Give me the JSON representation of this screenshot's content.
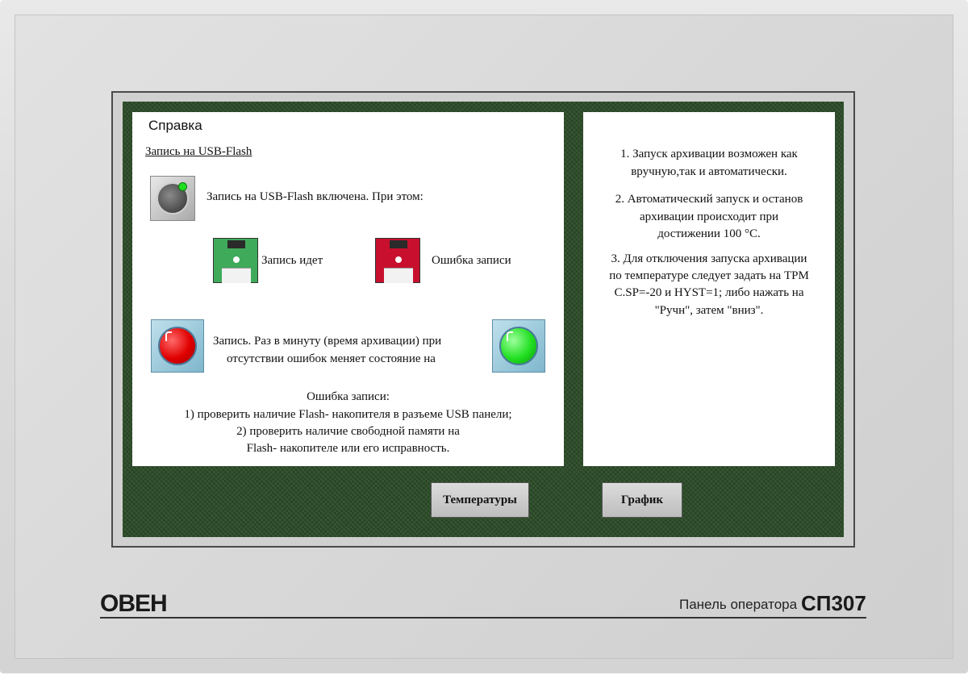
{
  "left_pane": {
    "title": "Справка",
    "subtitle": "Запись на USB-Flash",
    "usb_enabled_text": "Запись на USB-Flash включена. При этом:",
    "recording_label": "Запись идет",
    "error_label": "Ошибка записи",
    "lamp_text_line1": "Запись. Раз в минуту (время архивации) при",
    "lamp_text_line2": "отсутствии ошибок меняет состояние на",
    "error_block": {
      "line1": "Ошибка записи:",
      "line2": "1) проверить наличие Flash- накопителя в разъеме USB панели;",
      "line3": "2) проверить наличие свободной  памяти на",
      "line4": "Flash- накопителе или его исправность."
    }
  },
  "right_pane": {
    "item1_line1": "1. Запуск архивации возможен как",
    "item1_line2": "вручную,так и автоматически.",
    "item2_line1": "2. Автоматический запуск и останов",
    "item2_line2": "архивации происходит при",
    "item2_line3": "достижении 100 °С.",
    "item3_line1": "3. Для отключения запуска архивации",
    "item3_line2": "по температуре следует задать на ТРМ",
    "item3_line3": "С.SP=-20 и HYST=1; либо нажать на",
    "item3_line4": "\"Ручн\", затем \"вниз\"."
  },
  "buttons": {
    "temperatures": "Температуры",
    "graph": "График"
  },
  "device": {
    "brand": "ОВЕН",
    "panel_label": "Панель оператора",
    "model": "СП307"
  },
  "icons": {
    "knob": "usb-record-switch-icon",
    "floppy_ok": "floppy-ok-icon",
    "floppy_error": "floppy-error-icon",
    "lamp_red": "red-lamp-icon",
    "lamp_green": "green-lamp-icon"
  },
  "colors": {
    "screen_background": "#2a4a26",
    "floppy_ok": "#3faa5a",
    "floppy_error": "#c8102e",
    "lamp_red": "#e00000",
    "lamp_green": "#22e022"
  }
}
